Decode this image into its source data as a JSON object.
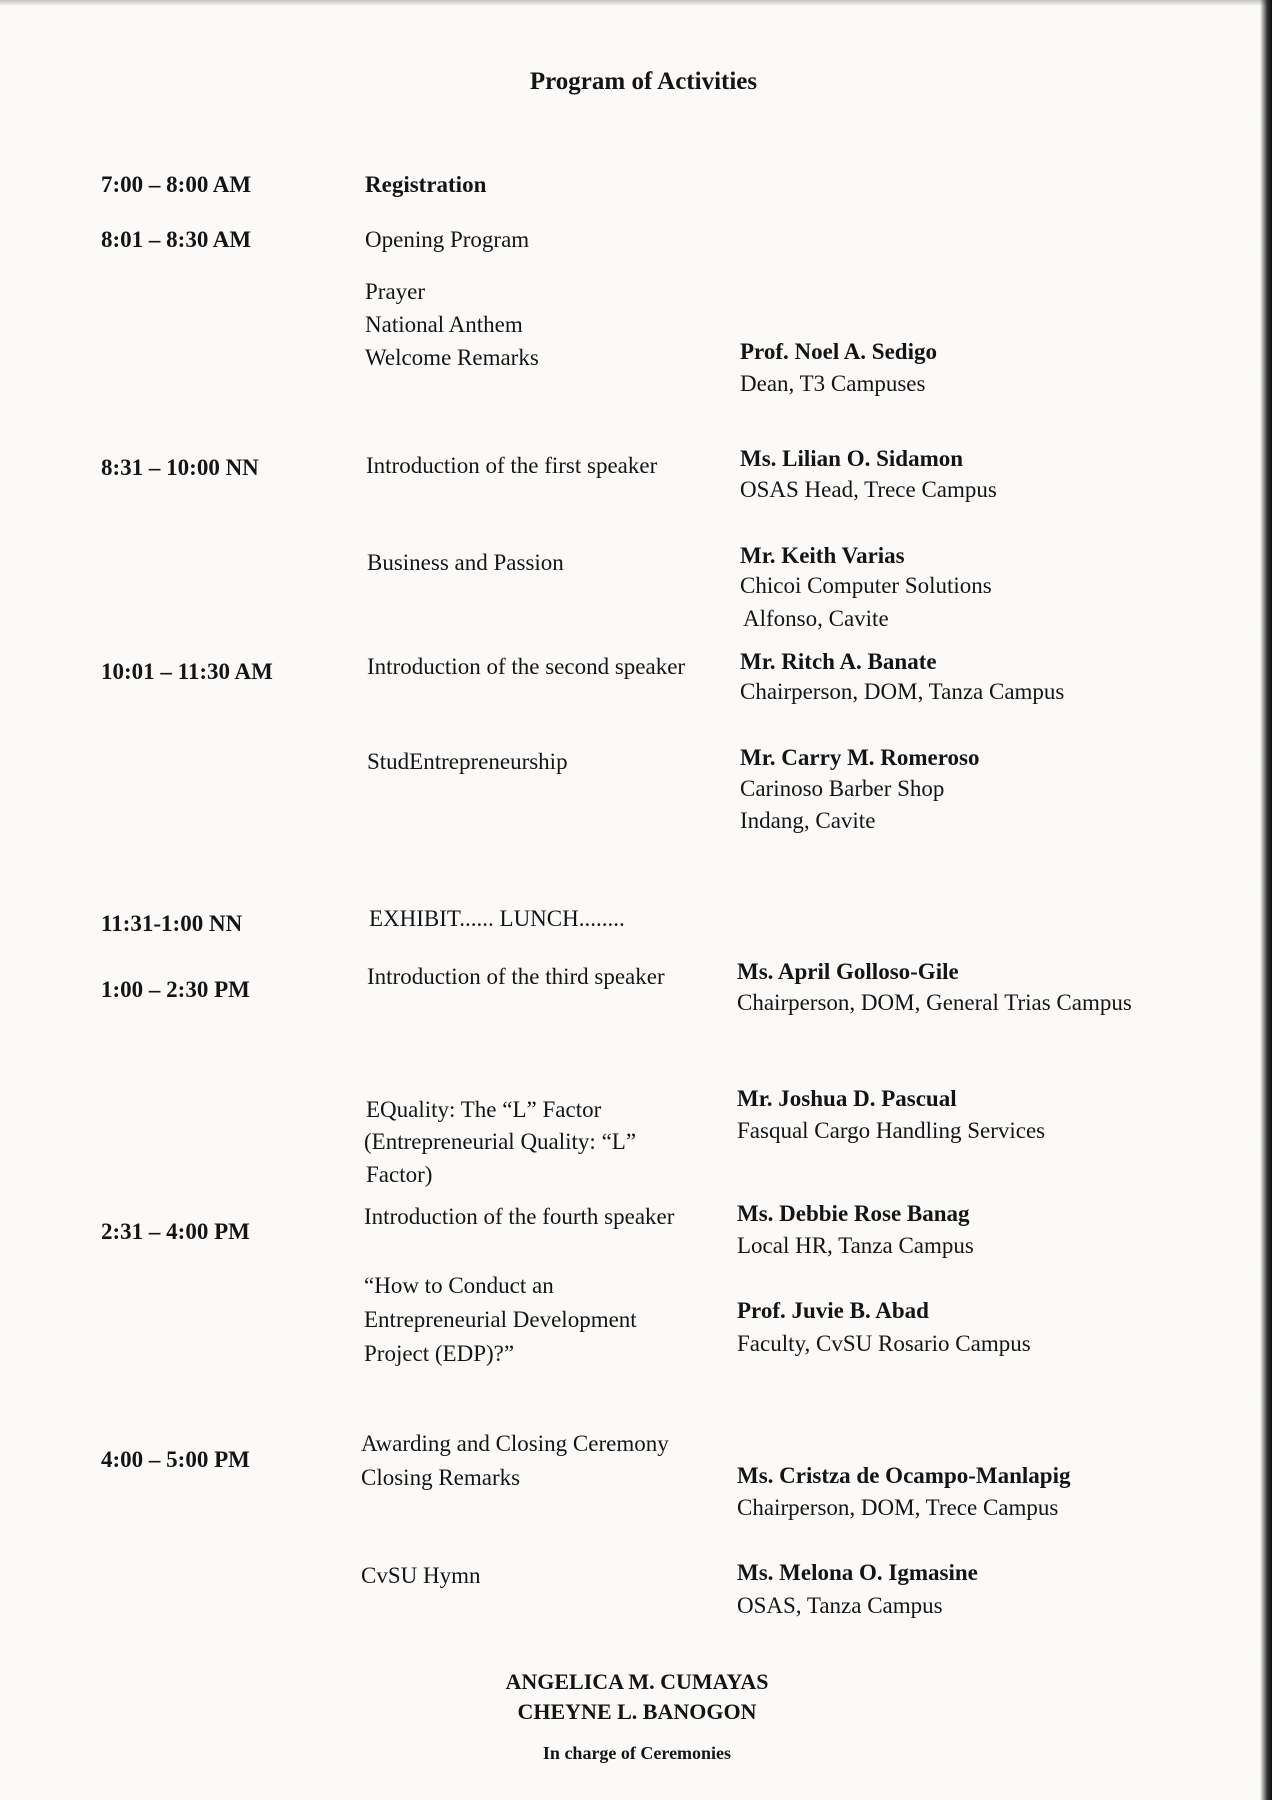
{
  "title": "Program of Activities",
  "schedule": [
    {
      "time": "7:00 – 8:00 AM",
      "activity": "Registration"
    },
    {
      "time": "8:01 – 8:30 AM",
      "activity": "Opening Program"
    },
    {
      "activity_lines": [
        "Prayer",
        "National Anthem",
        "Welcome Remarks"
      ],
      "speaker": "Prof. Noel A. Sedigo",
      "affiliation": [
        "Dean, T3 Campuses"
      ]
    },
    {
      "time": "8:31 – 10:00 NN",
      "activity": "Introduction of the first speaker",
      "speaker": "Ms. Lilian O. Sidamon",
      "affiliation": [
        "OSAS Head, Trece Campus"
      ]
    },
    {
      "activity": "Business and Passion",
      "speaker": "Mr. Keith Varias",
      "affiliation": [
        "Chicoi Computer Solutions",
        "Alfonso, Cavite"
      ]
    },
    {
      "time": "10:01 – 11:30 AM",
      "activity": "Introduction of the second speaker",
      "speaker": "Mr. Ritch A. Banate",
      "affiliation": [
        "Chairperson, DOM, Tanza Campus"
      ]
    },
    {
      "activity": "StudEntrepreneurship",
      "speaker": "Mr. Carry M. Romeroso",
      "affiliation": [
        "Carinoso Barber Shop",
        "Indang, Cavite"
      ]
    },
    {
      "time": "11:31-1:00 NN",
      "activity": "EXHIBIT...... LUNCH........"
    },
    {
      "time": "1:00 – 2:30 PM",
      "activity": "Introduction of the third speaker",
      "speaker": "Ms. April Golloso-Gile",
      "affiliation": [
        "Chairperson, DOM, General Trias Campus"
      ]
    },
    {
      "activity_lines": [
        "EQuality: The “L” Factor",
        "(Entrepreneurial Quality: “L”",
        "Factor)"
      ],
      "speaker": "Mr. Joshua D. Pascual",
      "affiliation": [
        "Fasqual Cargo Handling Services"
      ]
    },
    {
      "time": "2:31 – 4:00 PM",
      "activity": "Introduction of the fourth speaker",
      "speaker": "Ms. Debbie Rose Banag",
      "affiliation": [
        "Local HR, Tanza Campus"
      ]
    },
    {
      "activity_lines": [
        "“How to Conduct an",
        "Entrepreneurial Development",
        "Project (EDP)?”"
      ],
      "speaker": "Prof. Juvie B. Abad",
      "affiliation": [
        "Faculty, CvSU Rosario Campus"
      ]
    },
    {
      "time": "4:00 – 5:00 PM",
      "activity_lines": [
        "Awarding and Closing Ceremony",
        "Closing Remarks"
      ],
      "speaker": "Ms. Cristza de Ocampo-Manlapig",
      "affiliation": [
        "Chairperson, DOM, Trece Campus"
      ]
    },
    {
      "activity": "CvSU Hymn",
      "speaker": "Ms. Melona O. Igmasine",
      "affiliation": [
        "OSAS, Tanza Campus"
      ]
    }
  ],
  "footer": {
    "names": [
      "ANGELICA M. CUMAYAS",
      "CHEYNE L. BANOGON"
    ],
    "role": "In charge of Ceremonies"
  }
}
